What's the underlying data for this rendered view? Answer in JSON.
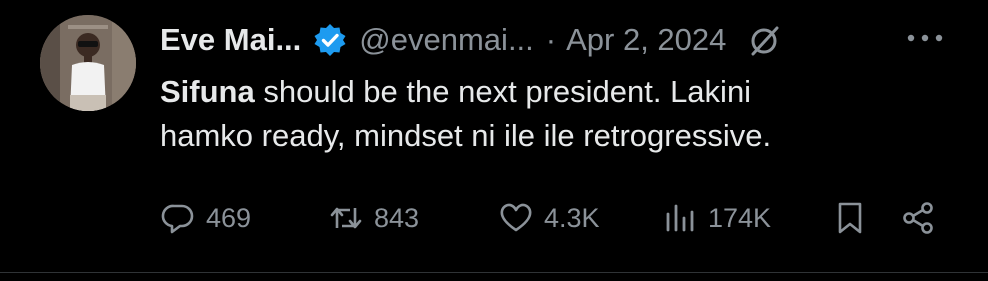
{
  "tweet": {
    "author_name": "Eve Mai...",
    "handle": "@evenmai...",
    "separator": "·",
    "date": "Apr 2, 2024",
    "more_icon": "more-horizontal-icon",
    "grok_icon": "grok-slash-icon",
    "verified_icon": "verified-badge-icon",
    "text_bold": "Sifuna",
    "text_line1_rest": " should be the next president. Lakini",
    "text_line2": "hamko ready, mindset ni ile ile retrogressive.",
    "replies": "469",
    "reposts": "843",
    "likes": "4.3K",
    "views": "174K"
  },
  "colors": {
    "background": "#000000",
    "text": "#e7e9ea",
    "muted": "#8b9299",
    "verified": "#1d9bf0"
  }
}
